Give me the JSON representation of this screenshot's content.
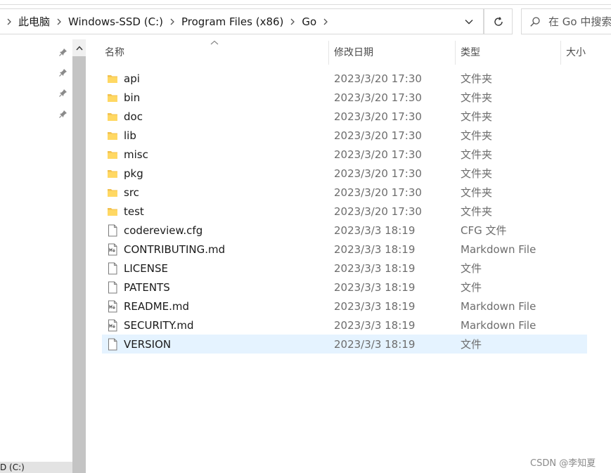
{
  "address_bar": {
    "breadcrumbs": [
      "此电脑",
      "Windows-SSD (C:)",
      "Program Files (x86)",
      "Go"
    ]
  },
  "search": {
    "placeholder": "在 Go 中搜索"
  },
  "navigation": {
    "partial_drive_label": "D (C:)"
  },
  "columns": {
    "name": "名称",
    "date": "修改日期",
    "type": "类型",
    "size": "大小"
  },
  "files": [
    {
      "name": "api",
      "date": "2023/3/20 17:30",
      "type": "文件夹",
      "icon": "folder-icon"
    },
    {
      "name": "bin",
      "date": "2023/3/20 17:30",
      "type": "文件夹",
      "icon": "folder-icon"
    },
    {
      "name": "doc",
      "date": "2023/3/20 17:30",
      "type": "文件夹",
      "icon": "folder-icon"
    },
    {
      "name": "lib",
      "date": "2023/3/20 17:30",
      "type": "文件夹",
      "icon": "folder-icon"
    },
    {
      "name": "misc",
      "date": "2023/3/20 17:30",
      "type": "文件夹",
      "icon": "folder-icon"
    },
    {
      "name": "pkg",
      "date": "2023/3/20 17:30",
      "type": "文件夹",
      "icon": "folder-icon"
    },
    {
      "name": "src",
      "date": "2023/3/20 17:30",
      "type": "文件夹",
      "icon": "folder-icon"
    },
    {
      "name": "test",
      "date": "2023/3/20 17:30",
      "type": "文件夹",
      "icon": "folder-icon"
    },
    {
      "name": "codereview.cfg",
      "date": "2023/3/3 18:19",
      "type": "CFG 文件",
      "icon": "file-icon"
    },
    {
      "name": "CONTRIBUTING.md",
      "date": "2023/3/3 18:19",
      "type": "Markdown File",
      "icon": "markdown-file-icon"
    },
    {
      "name": "LICENSE",
      "date": "2023/3/3 18:19",
      "type": "文件",
      "icon": "file-icon"
    },
    {
      "name": "PATENTS",
      "date": "2023/3/3 18:19",
      "type": "文件",
      "icon": "file-icon"
    },
    {
      "name": "README.md",
      "date": "2023/3/3 18:19",
      "type": "Markdown File",
      "icon": "markdown-file-icon"
    },
    {
      "name": "SECURITY.md",
      "date": "2023/3/3 18:19",
      "type": "Markdown File",
      "icon": "markdown-file-icon"
    },
    {
      "name": "VERSION",
      "date": "2023/3/3 18:19",
      "type": "文件",
      "icon": "file-icon",
      "selected": true
    }
  ],
  "watermark": "CSDN @李知夏",
  "colors": {
    "selection": "#e5f3ff",
    "folder": "#f2c14e",
    "scrollbar": "#c4c4c4"
  }
}
